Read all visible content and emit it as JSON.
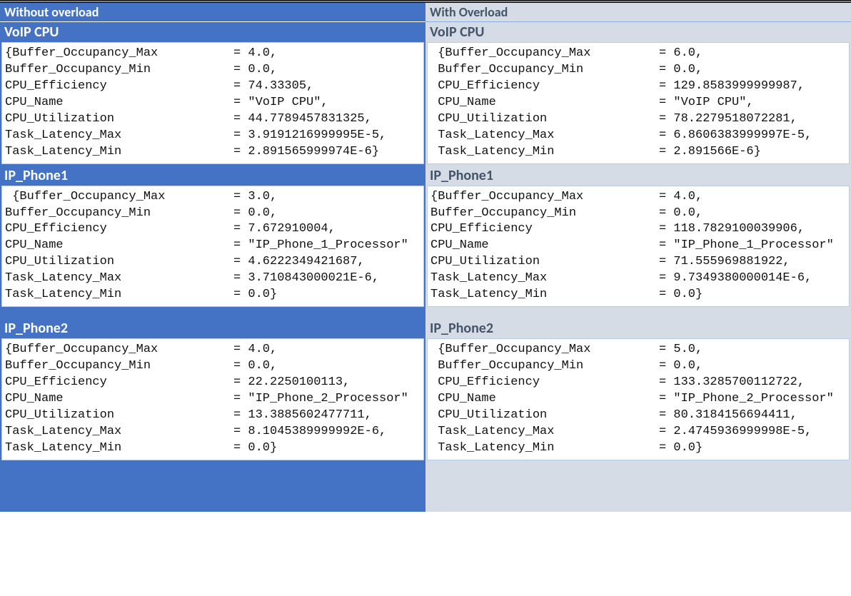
{
  "headers": {
    "left": "Without overload",
    "right": "With Overload"
  },
  "sections": [
    "VoIP CPU",
    "IP_Phone1",
    "IP_Phone2"
  ],
  "left": {
    "voip": {
      "title": "VoIP CPU",
      "rows": [
        {
          "key": "{Buffer_Occupancy_Max",
          "val": "= 4.0,"
        },
        {
          "key": "Buffer_Occupancy_Min",
          "val": "= 0.0,"
        },
        {
          "key": "CPU_Efficiency",
          "val": "= 74.33305,"
        },
        {
          "key": "CPU_Name",
          "val": "= \"VoIP CPU\","
        },
        {
          "key": "CPU_Utilization",
          "val": "= 44.7789457831325,"
        },
        {
          "key": "Task_Latency_Max",
          "val": "= 3.9191216999995E-5,"
        },
        {
          "key": "Task_Latency_Min",
          "val": "= 2.891565999974E-6}"
        }
      ]
    },
    "ip1": {
      "title": "IP_Phone1",
      "rows": [
        {
          "key": " {Buffer_Occupancy_Max",
          "val": "= 3.0,"
        },
        {
          "key": "Buffer_Occupancy_Min",
          "val": "= 0.0,"
        },
        {
          "key": "CPU_Efficiency",
          "val": "= 7.672910004,"
        },
        {
          "key": "CPU_Name",
          "val": "= \"IP_Phone_1_Processor\""
        },
        {
          "key": "CPU_Utilization",
          "val": "= 4.6222349421687,"
        },
        {
          "key": "Task_Latency_Max",
          "val": "= 3.710843000021E-6,"
        },
        {
          "key": "Task_Latency_Min",
          "val": "= 0.0}"
        }
      ]
    },
    "ip2": {
      "title": "IP_Phone2",
      "rows": [
        {
          "key": "{Buffer_Occupancy_Max",
          "val": "= 4.0,"
        },
        {
          "key": "Buffer_Occupancy_Min",
          "val": "= 0.0,"
        },
        {
          "key": "CPU_Efficiency",
          "val": "= 22.2250100113,"
        },
        {
          "key": "CPU_Name",
          "val": "= \"IP_Phone_2_Processor\""
        },
        {
          "key": "CPU_Utilization",
          "val": "= 13.3885602477711,"
        },
        {
          "key": "Task_Latency_Max",
          "val": "= 8.1045389999992E-6,"
        },
        {
          "key": "Task_Latency_Min",
          "val": "= 0.0}"
        }
      ]
    }
  },
  "right": {
    "voip": {
      "title": "VoIP CPU",
      "rows": [
        {
          "key": " {Buffer_Occupancy_Max",
          "val": "= 6.0,"
        },
        {
          "key": " Buffer_Occupancy_Min",
          "val": "= 0.0,"
        },
        {
          "key": " CPU_Efficiency",
          "val": "= 129.8583999999987,"
        },
        {
          "key": " CPU_Name",
          "val": "= \"VoIP CPU\","
        },
        {
          "key": " CPU_Utilization",
          "val": "= 78.2279518072281,"
        },
        {
          "key": " Task_Latency_Max",
          "val": "= 6.8606383999997E-5,"
        },
        {
          "key": " Task_Latency_Min",
          "val": "= 2.891566E-6}"
        }
      ]
    },
    "ip1": {
      "title": "IP_Phone1",
      "rows": [
        {
          "key": "{Buffer_Occupancy_Max",
          "val": "= 4.0,"
        },
        {
          "key": "Buffer_Occupancy_Min",
          "val": "= 0.0,"
        },
        {
          "key": "CPU_Efficiency",
          "val": "= 118.7829100039906,"
        },
        {
          "key": "CPU_Name",
          "val": "= \"IP_Phone_1_Processor\""
        },
        {
          "key": "CPU_Utilization",
          "val": "= 71.555969881922,"
        },
        {
          "key": "Task_Latency_Max",
          "val": "= 9.7349380000014E-6,"
        },
        {
          "key": "Task_Latency_Min",
          "val": "= 0.0}"
        }
      ]
    },
    "ip2": {
      "title": "IP_Phone2",
      "rows": [
        {
          "key": " {Buffer_Occupancy_Max",
          "val": "= 5.0,"
        },
        {
          "key": " Buffer_Occupancy_Min",
          "val": "= 0.0,"
        },
        {
          "key": " CPU_Efficiency",
          "val": "= 133.3285700112722,"
        },
        {
          "key": " CPU_Name",
          "val": "= \"IP_Phone_2_Processor\""
        },
        {
          "key": " CPU_Utilization",
          "val": "= 80.3184156694411,"
        },
        {
          "key": " Task_Latency_Max",
          "val": "= 2.4745936999998E-5,"
        },
        {
          "key": " Task_Latency_Min",
          "val": "= 0.0}"
        }
      ]
    }
  }
}
